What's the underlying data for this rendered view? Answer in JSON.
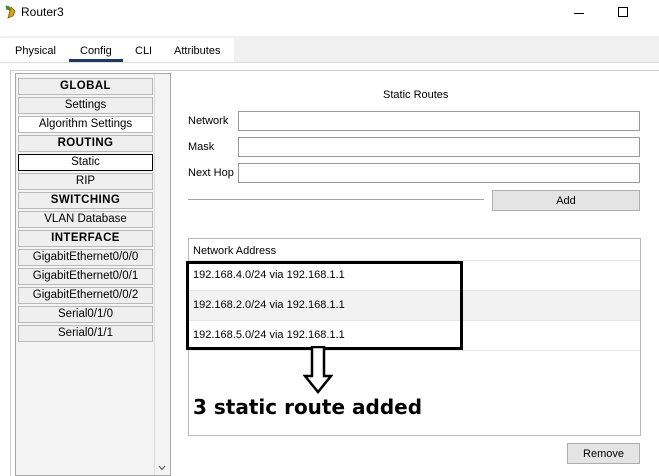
{
  "window": {
    "title": "Router3",
    "icon": "router-app-icon",
    "minimize_icon": "minimize-icon",
    "maximize_icon": "maximize-icon"
  },
  "tabs": [
    {
      "label": "Physical",
      "active": false
    },
    {
      "label": "Config",
      "active": true
    },
    {
      "label": "CLI",
      "active": false
    },
    {
      "label": "Attributes",
      "active": false
    }
  ],
  "sidebar": {
    "items": [
      {
        "label": "GLOBAL",
        "type": "header"
      },
      {
        "label": "Settings",
        "type": "item"
      },
      {
        "label": "Algorithm Settings",
        "type": "item"
      },
      {
        "label": "ROUTING",
        "type": "header"
      },
      {
        "label": "Static",
        "type": "item",
        "selected": true
      },
      {
        "label": "RIP",
        "type": "item"
      },
      {
        "label": "SWITCHING",
        "type": "header"
      },
      {
        "label": "VLAN Database",
        "type": "item"
      },
      {
        "label": "INTERFACE",
        "type": "header"
      },
      {
        "label": "GigabitEthernet0/0/0",
        "type": "item"
      },
      {
        "label": "GigabitEthernet0/0/1",
        "type": "item"
      },
      {
        "label": "GigabitEthernet0/0/2",
        "type": "item"
      },
      {
        "label": "Serial0/1/0",
        "type": "item"
      },
      {
        "label": "Serial0/1/1",
        "type": "item"
      }
    ],
    "scroll_icon": "chevron-down-icon"
  },
  "static_routes": {
    "title": "Static Routes",
    "fields": {
      "network": {
        "label": "Network",
        "value": ""
      },
      "mask": {
        "label": "Mask",
        "value": ""
      },
      "next_hop": {
        "label": "Next Hop",
        "value": ""
      }
    },
    "add_label": "Add",
    "remove_label": "Remove",
    "table": {
      "header": "Network Address",
      "rows": [
        "192.168.4.0/24 via 192.168.1.1",
        "192.168.2.0/24 via 192.168.1.1",
        "192.168.5.0/24 via 192.168.1.1"
      ]
    }
  },
  "annotation": {
    "text": "3 static route added",
    "arrow_icon": "down-arrow-icon"
  },
  "colors": {
    "tab_underline": "#1e3a5f",
    "selected_border": "#000000",
    "button_bg": "#e4e4e4"
  }
}
